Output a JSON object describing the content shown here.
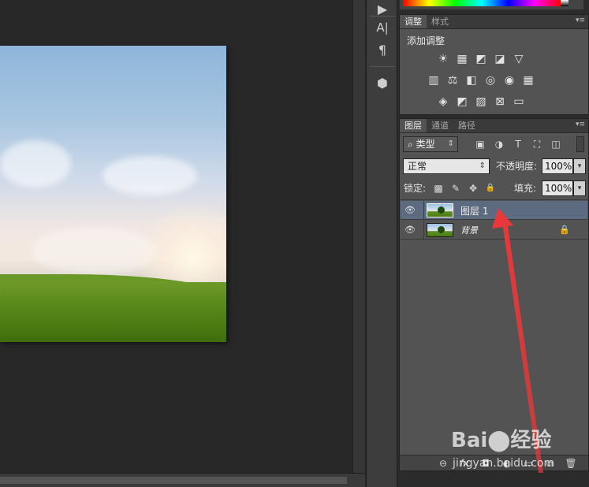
{
  "toolstrip": {
    "icons": [
      "play-icon",
      "character-icon",
      "paragraph-icon",
      "3d-cube-icon"
    ],
    "glyphs": [
      "▶",
      "A|",
      "¶",
      "⬢"
    ]
  },
  "adjustments": {
    "tabs": [
      "调整",
      "样式"
    ],
    "title": "添加调整",
    "rows": [
      [
        "☀",
        "▦",
        "◩",
        "◪",
        "▽"
      ],
      [
        "▥",
        "⚖",
        "◧",
        "◎",
        "◉",
        "▦"
      ],
      [
        "◈",
        "◩",
        "▨",
        "⊠",
        "▭"
      ]
    ]
  },
  "layers": {
    "tabs": [
      "图层",
      "通道",
      "路径"
    ],
    "filter_label": "类型",
    "filter_icons": [
      "▣",
      "◑",
      "T",
      "⛶",
      "◫"
    ],
    "blend_mode": "正常",
    "opacity_label": "不透明度:",
    "opacity_value": "100%",
    "lock_label": "锁定:",
    "lock_icons": [
      "▩",
      "✎",
      "✥",
      "🔒"
    ],
    "fill_label": "填充:",
    "fill_value": "100%",
    "items": [
      {
        "name": "图层 1",
        "selected": true,
        "locked": false
      },
      {
        "name": "背景",
        "selected": false,
        "locked": true
      }
    ],
    "footer_icons": [
      "⊖",
      "fx",
      "◘",
      "◐",
      "▭",
      "⧉",
      "🗑"
    ]
  },
  "watermark": {
    "logo": "Bai⬤经验",
    "url": "jingyan.baidu.com"
  },
  "colors": {
    "selection": "#5c6b80",
    "annotation_arrow": "#e8383a"
  }
}
